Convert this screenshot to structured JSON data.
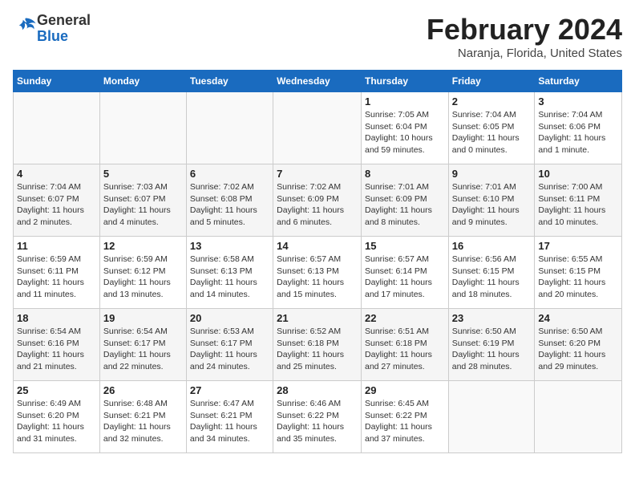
{
  "header": {
    "logo_line1": "General",
    "logo_line2": "Blue",
    "month_year": "February 2024",
    "location": "Naranja, Florida, United States"
  },
  "weekdays": [
    "Sunday",
    "Monday",
    "Tuesday",
    "Wednesday",
    "Thursday",
    "Friday",
    "Saturday"
  ],
  "weeks": [
    [
      {
        "day": "",
        "info": ""
      },
      {
        "day": "",
        "info": ""
      },
      {
        "day": "",
        "info": ""
      },
      {
        "day": "",
        "info": ""
      },
      {
        "day": "1",
        "info": "Sunrise: 7:05 AM\nSunset: 6:04 PM\nDaylight: 10 hours\nand 59 minutes."
      },
      {
        "day": "2",
        "info": "Sunrise: 7:04 AM\nSunset: 6:05 PM\nDaylight: 11 hours\nand 0 minutes."
      },
      {
        "day": "3",
        "info": "Sunrise: 7:04 AM\nSunset: 6:06 PM\nDaylight: 11 hours\nand 1 minute."
      }
    ],
    [
      {
        "day": "4",
        "info": "Sunrise: 7:04 AM\nSunset: 6:07 PM\nDaylight: 11 hours\nand 2 minutes."
      },
      {
        "day": "5",
        "info": "Sunrise: 7:03 AM\nSunset: 6:07 PM\nDaylight: 11 hours\nand 4 minutes."
      },
      {
        "day": "6",
        "info": "Sunrise: 7:02 AM\nSunset: 6:08 PM\nDaylight: 11 hours\nand 5 minutes."
      },
      {
        "day": "7",
        "info": "Sunrise: 7:02 AM\nSunset: 6:09 PM\nDaylight: 11 hours\nand 6 minutes."
      },
      {
        "day": "8",
        "info": "Sunrise: 7:01 AM\nSunset: 6:09 PM\nDaylight: 11 hours\nand 8 minutes."
      },
      {
        "day": "9",
        "info": "Sunrise: 7:01 AM\nSunset: 6:10 PM\nDaylight: 11 hours\nand 9 minutes."
      },
      {
        "day": "10",
        "info": "Sunrise: 7:00 AM\nSunset: 6:11 PM\nDaylight: 11 hours\nand 10 minutes."
      }
    ],
    [
      {
        "day": "11",
        "info": "Sunrise: 6:59 AM\nSunset: 6:11 PM\nDaylight: 11 hours\nand 11 minutes."
      },
      {
        "day": "12",
        "info": "Sunrise: 6:59 AM\nSunset: 6:12 PM\nDaylight: 11 hours\nand 13 minutes."
      },
      {
        "day": "13",
        "info": "Sunrise: 6:58 AM\nSunset: 6:13 PM\nDaylight: 11 hours\nand 14 minutes."
      },
      {
        "day": "14",
        "info": "Sunrise: 6:57 AM\nSunset: 6:13 PM\nDaylight: 11 hours\nand 15 minutes."
      },
      {
        "day": "15",
        "info": "Sunrise: 6:57 AM\nSunset: 6:14 PM\nDaylight: 11 hours\nand 17 minutes."
      },
      {
        "day": "16",
        "info": "Sunrise: 6:56 AM\nSunset: 6:15 PM\nDaylight: 11 hours\nand 18 minutes."
      },
      {
        "day": "17",
        "info": "Sunrise: 6:55 AM\nSunset: 6:15 PM\nDaylight: 11 hours\nand 20 minutes."
      }
    ],
    [
      {
        "day": "18",
        "info": "Sunrise: 6:54 AM\nSunset: 6:16 PM\nDaylight: 11 hours\nand 21 minutes."
      },
      {
        "day": "19",
        "info": "Sunrise: 6:54 AM\nSunset: 6:17 PM\nDaylight: 11 hours\nand 22 minutes."
      },
      {
        "day": "20",
        "info": "Sunrise: 6:53 AM\nSunset: 6:17 PM\nDaylight: 11 hours\nand 24 minutes."
      },
      {
        "day": "21",
        "info": "Sunrise: 6:52 AM\nSunset: 6:18 PM\nDaylight: 11 hours\nand 25 minutes."
      },
      {
        "day": "22",
        "info": "Sunrise: 6:51 AM\nSunset: 6:18 PM\nDaylight: 11 hours\nand 27 minutes."
      },
      {
        "day": "23",
        "info": "Sunrise: 6:50 AM\nSunset: 6:19 PM\nDaylight: 11 hours\nand 28 minutes."
      },
      {
        "day": "24",
        "info": "Sunrise: 6:50 AM\nSunset: 6:20 PM\nDaylight: 11 hours\nand 29 minutes."
      }
    ],
    [
      {
        "day": "25",
        "info": "Sunrise: 6:49 AM\nSunset: 6:20 PM\nDaylight: 11 hours\nand 31 minutes."
      },
      {
        "day": "26",
        "info": "Sunrise: 6:48 AM\nSunset: 6:21 PM\nDaylight: 11 hours\nand 32 minutes."
      },
      {
        "day": "27",
        "info": "Sunrise: 6:47 AM\nSunset: 6:21 PM\nDaylight: 11 hours\nand 34 minutes."
      },
      {
        "day": "28",
        "info": "Sunrise: 6:46 AM\nSunset: 6:22 PM\nDaylight: 11 hours\nand 35 minutes."
      },
      {
        "day": "29",
        "info": "Sunrise: 6:45 AM\nSunset: 6:22 PM\nDaylight: 11 hours\nand 37 minutes."
      },
      {
        "day": "",
        "info": ""
      },
      {
        "day": "",
        "info": ""
      }
    ]
  ]
}
